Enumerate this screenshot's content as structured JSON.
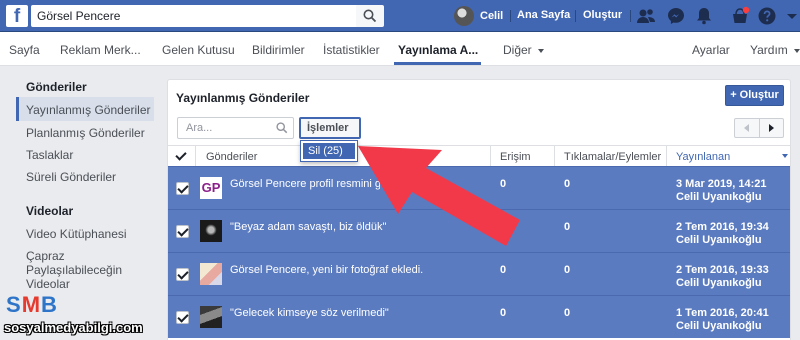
{
  "topbar": {
    "search_value": "Görsel Pencere",
    "profile_name": "Celil",
    "home_label": "Ana Sayfa",
    "create_label": "Oluştur"
  },
  "pagenav": {
    "items": [
      "Sayfa",
      "Reklam Merk...",
      "Gelen Kutusu",
      "Bildirimler",
      "İstatistikler",
      "Yayınlama A...",
      "Diğer"
    ],
    "active_index": 5,
    "settings_label": "Ayarlar",
    "help_label": "Yardım"
  },
  "sidebar": {
    "sections": [
      {
        "title": "Gönderiler",
        "items": [
          "Yayınlanmış Gönderiler",
          "Planlanmış Gönderiler",
          "Taslaklar",
          "Süreli Gönderiler"
        ]
      },
      {
        "title": "Videolar",
        "items": [
          "Video Kütüphanesi",
          "Çapraz Paylaşılabileceğin Videolar"
        ]
      }
    ],
    "active_item": "Yayınlanmış Gönderiler"
  },
  "main": {
    "title": "Yayınlanmış Gönderiler",
    "create_button": "+ Oluştur",
    "search_placeholder": "Ara...",
    "actions_button": "İşlemler",
    "actions_menu": [
      "Sil (25)"
    ],
    "columns": [
      "Gönderiler",
      "Erişim",
      "Tıklamalar/Eylemler",
      "Yayınlanan"
    ],
    "sorted_column": "Yayınlanan",
    "rows": [
      {
        "thumb": "GP",
        "text": "Görsel Pencere profil resmini günc",
        "reach": "0",
        "clicks": "0",
        "date": "3 Mar 2019, 14:21",
        "author": "Celil Uyanıkoğlu"
      },
      {
        "thumb": "photo-dark",
        "text": "\"Beyaz adam savaştı, biz öldük\"",
        "reach": "0",
        "clicks": "0",
        "date": "2 Tem 2016, 19:34",
        "author": "Celil Uyanıkoğlu"
      },
      {
        "thumb": "photo-light",
        "text": "Görsel Pencere, yeni bir fotoğraf ekledi.",
        "reach": "0",
        "clicks": "0",
        "date": "2 Tem 2016, 19:33",
        "author": "Celil Uyanıkoğlu"
      },
      {
        "thumb": "photo-gray",
        "text": "\"Gelecek kimseye söz verilmedi\"",
        "reach": "0",
        "clicks": "0",
        "date": "1 Tem 2016, 20:41",
        "author": "Celil Uyanıkoğlu"
      }
    ]
  },
  "watermark": {
    "brand": "SMB",
    "url": "sosyalmedyabilgi.com"
  },
  "colors": {
    "brand_blue": "#4267b2",
    "row_selected": "#5b7bc0",
    "arrow": "#f2394a"
  }
}
